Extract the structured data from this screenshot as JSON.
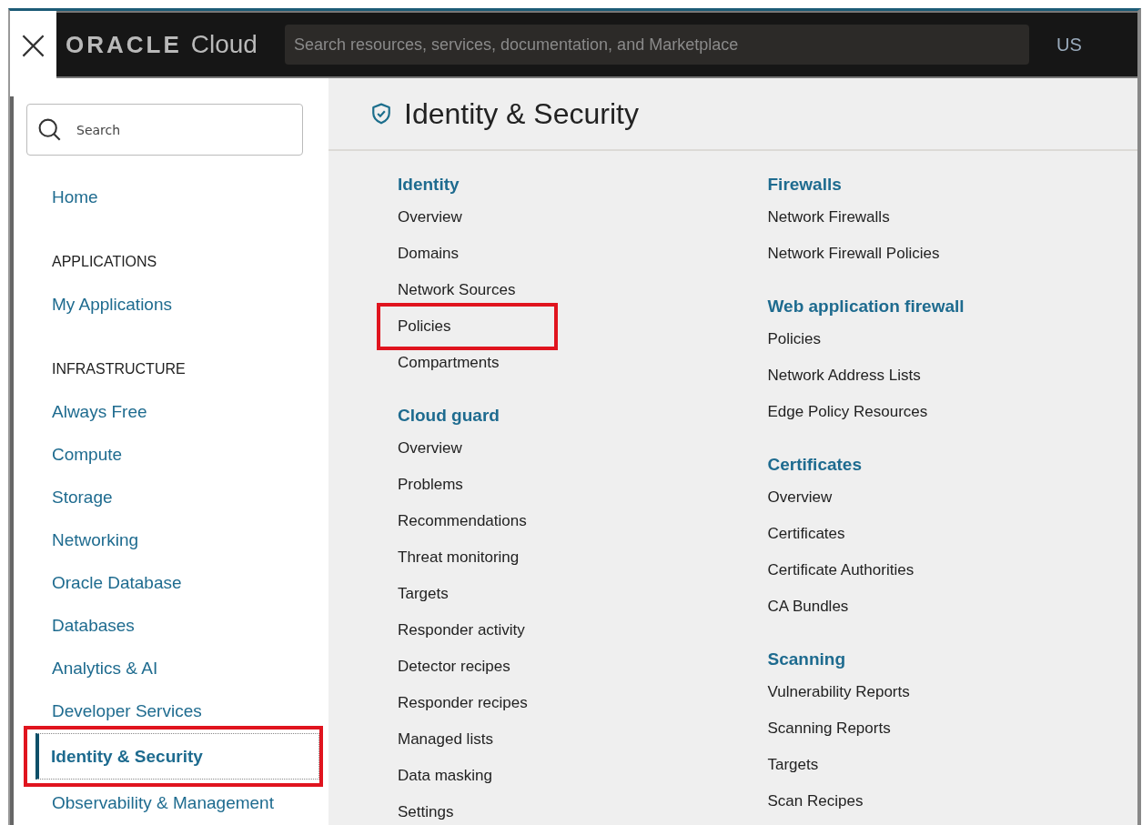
{
  "header": {
    "close": "×",
    "logo": {
      "brand": "ORACLE",
      "product": "Cloud"
    },
    "search": {
      "placeholder": "Search resources, services, documentation, and Marketplace"
    },
    "region": "US"
  },
  "sidebar": {
    "search": {
      "placeholder": "Search"
    },
    "items": [
      {
        "kind": "link",
        "label": "Home",
        "selected": false,
        "highlighted": false
      },
      {
        "kind": "heading",
        "label": "APPLICATIONS"
      },
      {
        "kind": "link",
        "label": "My Applications",
        "selected": false,
        "highlighted": false
      },
      {
        "kind": "heading",
        "label": "INFRASTRUCTURE"
      },
      {
        "kind": "link",
        "label": "Always Free",
        "selected": false,
        "highlighted": false
      },
      {
        "kind": "link",
        "label": "Compute",
        "selected": false,
        "highlighted": false
      },
      {
        "kind": "link",
        "label": "Storage",
        "selected": false,
        "highlighted": false
      },
      {
        "kind": "link",
        "label": "Networking",
        "selected": false,
        "highlighted": false
      },
      {
        "kind": "link",
        "label": "Oracle Database",
        "selected": false,
        "highlighted": false
      },
      {
        "kind": "link",
        "label": "Databases",
        "selected": false,
        "highlighted": false
      },
      {
        "kind": "link",
        "label": "Analytics & AI",
        "selected": false,
        "highlighted": false
      },
      {
        "kind": "link",
        "label": "Developer Services",
        "selected": false,
        "highlighted": false
      },
      {
        "kind": "link",
        "label": "Identity & Security",
        "selected": true,
        "highlighted": true
      },
      {
        "kind": "link",
        "label": "Observability & Management",
        "selected": false,
        "highlighted": false
      }
    ]
  },
  "main": {
    "title": "Identity & Security",
    "columns": [
      [
        {
          "heading": "Identity",
          "links": [
            {
              "label": "Overview",
              "highlighted": false
            },
            {
              "label": "Domains",
              "highlighted": false
            },
            {
              "label": "Network Sources",
              "highlighted": false
            },
            {
              "label": "Policies",
              "highlighted": true
            },
            {
              "label": "Compartments",
              "highlighted": false
            }
          ]
        },
        {
          "heading": "Cloud guard",
          "links": [
            {
              "label": "Overview",
              "highlighted": false
            },
            {
              "label": "Problems",
              "highlighted": false
            },
            {
              "label": "Recommendations",
              "highlighted": false
            },
            {
              "label": "Threat monitoring",
              "highlighted": false
            },
            {
              "label": "Targets",
              "highlighted": false
            },
            {
              "label": "Responder activity",
              "highlighted": false
            },
            {
              "label": "Detector recipes",
              "highlighted": false
            },
            {
              "label": "Responder recipes",
              "highlighted": false
            },
            {
              "label": "Managed lists",
              "highlighted": false
            },
            {
              "label": "Data masking",
              "highlighted": false
            },
            {
              "label": "Settings",
              "highlighted": false
            }
          ]
        }
      ],
      [
        {
          "heading": "Firewalls",
          "links": [
            {
              "label": "Network Firewalls",
              "highlighted": false
            },
            {
              "label": "Network Firewall Policies",
              "highlighted": false
            }
          ]
        },
        {
          "heading": "Web application firewall",
          "links": [
            {
              "label": "Policies",
              "highlighted": false
            },
            {
              "label": "Network Address Lists",
              "highlighted": false
            },
            {
              "label": "Edge Policy Resources",
              "highlighted": false
            }
          ]
        },
        {
          "heading": "Certificates",
          "links": [
            {
              "label": "Overview",
              "highlighted": false
            },
            {
              "label": "Certificates",
              "highlighted": false
            },
            {
              "label": "Certificate Authorities",
              "highlighted": false
            },
            {
              "label": "CA Bundles",
              "highlighted": false
            }
          ]
        },
        {
          "heading": "Scanning",
          "links": [
            {
              "label": "Vulnerability Reports",
              "highlighted": false
            },
            {
              "label": "Scanning Reports",
              "highlighted": false
            },
            {
              "label": "Targets",
              "highlighted": false
            },
            {
              "label": "Scan Recipes",
              "highlighted": false
            }
          ]
        }
      ]
    ]
  }
}
